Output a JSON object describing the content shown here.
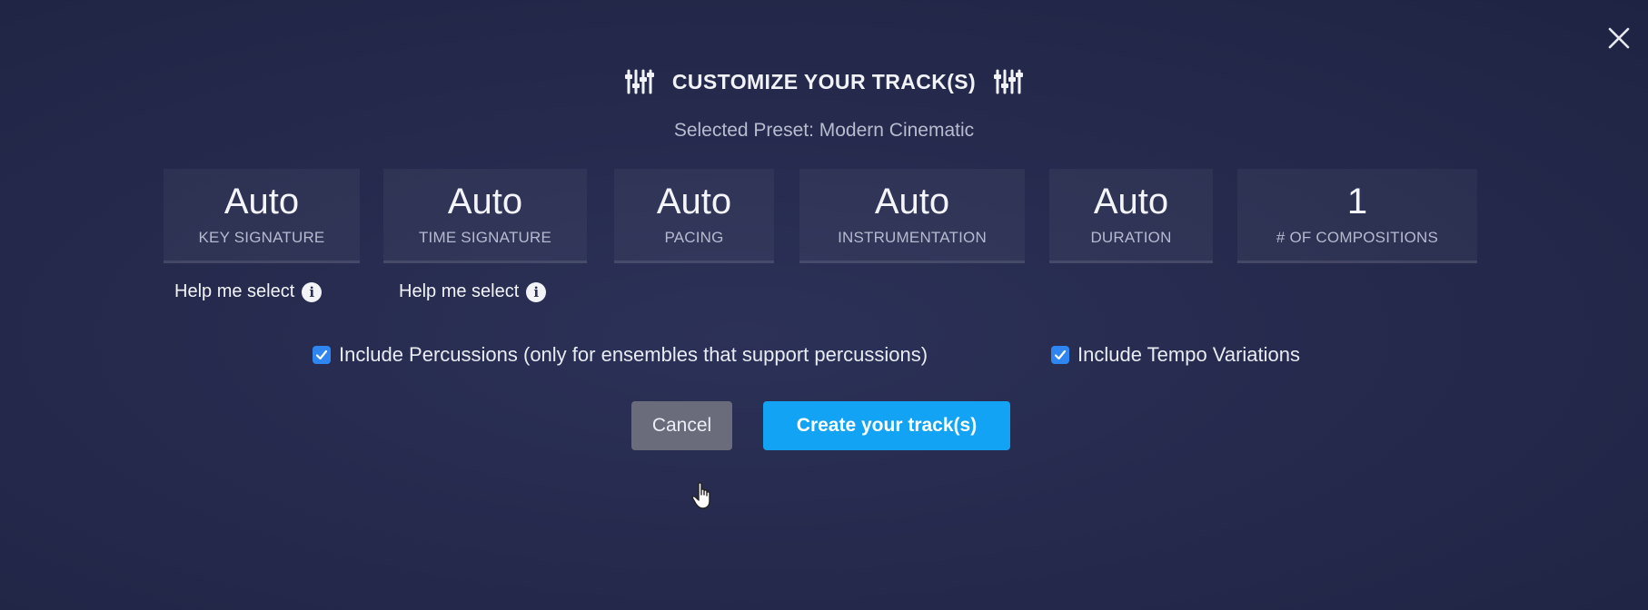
{
  "dialog": {
    "title": "CUSTOMIZE YOUR TRACK(S)",
    "left_icon": "mixer-sliders-icon",
    "right_icon": "mixer-sliders-icon",
    "close_icon": "close-icon",
    "subtitle": "Selected Preset: Modern Cinematic"
  },
  "settings": [
    {
      "value": "Auto",
      "label": "KEY SIGNATURE"
    },
    {
      "value": "Auto",
      "label": "TIME SIGNATURE"
    },
    {
      "value": "Auto",
      "label": "PACING"
    },
    {
      "value": "Auto",
      "label": "INSTRUMENTATION"
    },
    {
      "value": "Auto",
      "label": "DURATION"
    },
    {
      "value": "1",
      "label": "# OF COMPOSITIONS"
    }
  ],
  "help_links": [
    {
      "label": "Help me select",
      "icon": "info-icon"
    },
    {
      "label": "Help me select",
      "icon": "info-icon"
    }
  ],
  "options": [
    {
      "label": "Include Percussions (only for ensembles that support percussions)",
      "checked": true
    },
    {
      "label": "Include Tempo Variations",
      "checked": true
    }
  ],
  "actions": {
    "cancel_label": "Cancel",
    "create_label": "Create your track(s)"
  },
  "colors": {
    "background": "#262a4d",
    "primary_button": "#13a3f4",
    "secondary_button": "#6a6c7c",
    "checkbox": "#2f86f0"
  }
}
